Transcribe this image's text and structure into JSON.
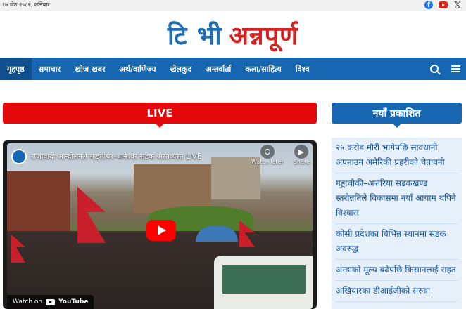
{
  "topbar": {
    "date": "१७ जेठ २०८२, शनिबार",
    "social": [
      "facebook-icon",
      "youtube-icon",
      "x-icon"
    ]
  },
  "logo": {
    "part1": "टि भी",
    "part2": "अन्नपूर्ण",
    "colors": {
      "part1": "#1f6fb5",
      "part2": "#d42222"
    }
  },
  "nav": {
    "items": [
      {
        "label": "गृहपृष्ठ",
        "active": true
      },
      {
        "label": "समाचार"
      },
      {
        "label": "खोज खबर"
      },
      {
        "label": "अर्थ/वाणिज्य"
      },
      {
        "label": "खेलकुद"
      },
      {
        "label": "अन्तर्वार्ता"
      },
      {
        "label": "कला/साहित्य"
      },
      {
        "label": "विश्व"
      }
    ],
    "icons": [
      "search-icon",
      "menu-icon"
    ],
    "color": "#1766b1"
  },
  "live": {
    "label": "LIVE",
    "color": "#e4080a"
  },
  "video": {
    "title": "राजावादी आन्दोलनले माइतीघर–बानेश्वर सडक अस्तव्यस्त LIVE",
    "watch_later": "Watch later",
    "share": "Share",
    "watch_on": "Watch on",
    "youtube": "YouTube"
  },
  "latest": {
    "heading": "नयाँ प्रकाशित",
    "items": [
      "२५ करोड मौरी भागेपछि सावधानी अपनाउन अमेरिकी प्रहरीको चेतावनी",
      "गड्डाचौकी–अत्तरिया सडकखण्ड स्तरोन्नतिले विकासमा नयाँ आयाम थपिने विश्वास",
      "कोसी प्रदेशका विभिन्न स्थानमा सडक अवरुद्ध",
      "अन्डाको मूल्य बढेपछि किसानलाई राहत",
      "अखियारका डीआईजीको सरुवा"
    ]
  }
}
